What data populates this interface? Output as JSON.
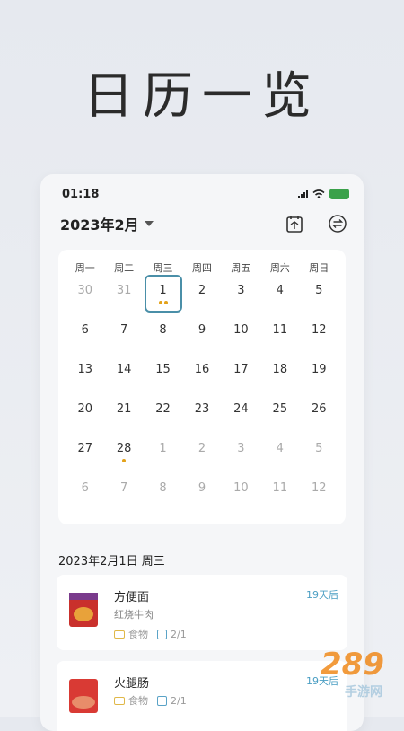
{
  "hero_title": "日历一览",
  "status": {
    "time": "01:18"
  },
  "header": {
    "month": "2023年2月"
  },
  "weekdays": [
    "周一",
    "周二",
    "周三",
    "周四",
    "周五",
    "周六",
    "周日"
  ],
  "calendar": {
    "rows": [
      [
        "30",
        "31",
        "1",
        "2",
        "3",
        "4",
        "5"
      ],
      [
        "6",
        "7",
        "8",
        "9",
        "10",
        "11",
        "12"
      ],
      [
        "13",
        "14",
        "15",
        "16",
        "17",
        "18",
        "19"
      ],
      [
        "20",
        "21",
        "22",
        "23",
        "24",
        "25",
        "26"
      ],
      [
        "27",
        "28",
        "1",
        "2",
        "3",
        "4",
        "5"
      ],
      [
        "6",
        "7",
        "8",
        "9",
        "10",
        "11",
        "12"
      ]
    ]
  },
  "selected_date_title": "2023年2月1日 周三",
  "items": [
    {
      "name": "方便面",
      "sub": "红烧牛肉",
      "category": "食物",
      "date": "2/1",
      "days": "19天后"
    },
    {
      "name": "火腿肠",
      "sub": "",
      "category": "食物",
      "date": "2/1",
      "days": "19天后"
    }
  ],
  "watermark": {
    "logo": "289",
    "site": "手游网"
  },
  "colors": {
    "accent": "#4a8fa8",
    "dot": "#e3a21a",
    "days": "#4a9ec3"
  }
}
